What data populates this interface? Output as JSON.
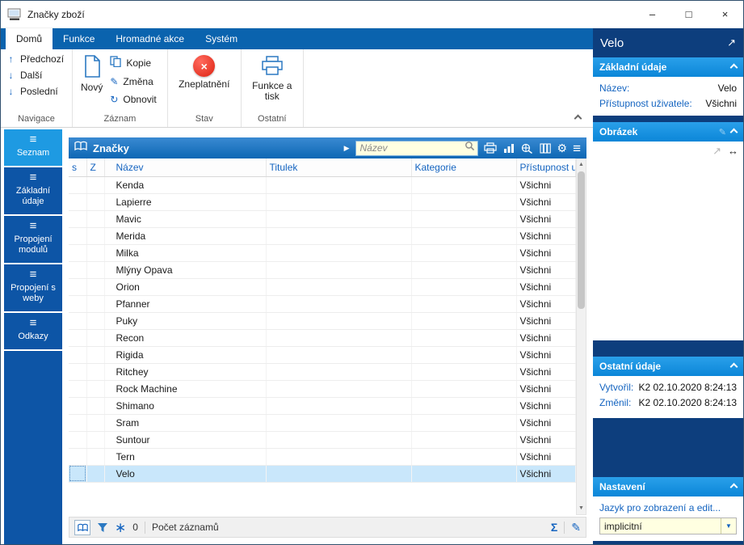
{
  "titlebar": {
    "title": "Značky zboží"
  },
  "icons": {
    "minimize": "–",
    "maximize": "□",
    "close": "×",
    "cross": "×",
    "arrow_up": "↑",
    "arrow_down": "↓",
    "triangle_right": "▶",
    "pencil": "✎",
    "refresh": "↻",
    "gear": "⚙",
    "menu": "≡",
    "sum": "Σ",
    "star": "∗",
    "expand": "↗",
    "resize_h": "↔",
    "dropdown": "▼",
    "scroll_up": "▲",
    "scroll_down": "▼"
  },
  "ribbon": {
    "tabs": [
      {
        "label": "Domů",
        "active": true
      },
      {
        "label": "Funkce",
        "active": false
      },
      {
        "label": "Hromadné akce",
        "active": false
      },
      {
        "label": "Systém",
        "active": false
      }
    ],
    "navigace": {
      "items": [
        {
          "icon": "↑",
          "label": "Předchozí"
        },
        {
          "icon": "↓",
          "label": "Další"
        },
        {
          "icon": "↓",
          "label": "Poslední"
        }
      ],
      "group_label": "Navigace"
    },
    "zaznam": {
      "novy": "Nový",
      "kopie": "Kopie",
      "zmena": "Změna",
      "obnovit": "Obnovit",
      "group_label": "Záznam"
    },
    "stav": {
      "zneplatneni": "Zneplatnění",
      "group_label": "Stav"
    },
    "ostatni": {
      "funkce_a_tisk": "Funkce a tisk",
      "group_label": "Ostatní"
    }
  },
  "sidebar": {
    "items": [
      {
        "label": "Seznam",
        "active": true
      },
      {
        "label": "Základní údaje",
        "active": false
      },
      {
        "label": "Propojení modulů",
        "active": false
      },
      {
        "label": "Propojení s weby",
        "active": false
      },
      {
        "label": "Odkazy",
        "active": false
      }
    ]
  },
  "table": {
    "panel_title": "Značky",
    "search_placeholder": "Název",
    "columns": {
      "s": "s",
      "z": "Z",
      "nazev": "Název",
      "titulek": "Titulek",
      "kategorie": "Kategorie",
      "pristupnost": "Přístupnost uživatele"
    },
    "rows": [
      {
        "nazev": "Kenda",
        "titulek": "",
        "kategorie": "",
        "pristupnost": "Všichni",
        "selected": false
      },
      {
        "nazev": "Lapierre",
        "titulek": "",
        "kategorie": "",
        "pristupnost": "Všichni",
        "selected": false
      },
      {
        "nazev": "Mavic",
        "titulek": "",
        "kategorie": "",
        "pristupnost": "Všichni",
        "selected": false
      },
      {
        "nazev": "Merida",
        "titulek": "",
        "kategorie": "",
        "pristupnost": "Všichni",
        "selected": false
      },
      {
        "nazev": "Milka",
        "titulek": "",
        "kategorie": "",
        "pristupnost": "Všichni",
        "selected": false
      },
      {
        "nazev": "Mlýny Opava",
        "titulek": "",
        "kategorie": "",
        "pristupnost": "Všichni",
        "selected": false
      },
      {
        "nazev": "Orion",
        "titulek": "",
        "kategorie": "",
        "pristupnost": "Všichni",
        "selected": false
      },
      {
        "nazev": "Pfanner",
        "titulek": "",
        "kategorie": "",
        "pristupnost": "Všichni",
        "selected": false
      },
      {
        "nazev": "Puky",
        "titulek": "",
        "kategorie": "",
        "pristupnost": "Všichni",
        "selected": false
      },
      {
        "nazev": "Recon",
        "titulek": "",
        "kategorie": "",
        "pristupnost": "Všichni",
        "selected": false
      },
      {
        "nazev": "Rigida",
        "titulek": "",
        "kategorie": "",
        "pristupnost": "Všichni",
        "selected": false
      },
      {
        "nazev": "Ritchey",
        "titulek": "",
        "kategorie": "",
        "pristupnost": "Všichni",
        "selected": false
      },
      {
        "nazev": "Rock Machine",
        "titulek": "",
        "kategorie": "",
        "pristupnost": "Všichni",
        "selected": false
      },
      {
        "nazev": "Shimano",
        "titulek": "",
        "kategorie": "",
        "pristupnost": "Všichni",
        "selected": false
      },
      {
        "nazev": "Sram",
        "titulek": "",
        "kategorie": "",
        "pristupnost": "Všichni",
        "selected": false
      },
      {
        "nazev": "Suntour",
        "titulek": "",
        "kategorie": "",
        "pristupnost": "Všichni",
        "selected": false
      },
      {
        "nazev": "Tern",
        "titulek": "",
        "kategorie": "",
        "pristupnost": "Všichni",
        "selected": false
      },
      {
        "nazev": "Velo",
        "titulek": "",
        "kategorie": "",
        "pristupnost": "Všichni",
        "selected": true
      }
    ]
  },
  "statusbar": {
    "count_value": "0",
    "count_label": "Počet záznamů"
  },
  "detail": {
    "title": "Velo",
    "zakladni": {
      "header": "Základní údaje",
      "rows": [
        {
          "label": "Název:",
          "value": "Velo"
        },
        {
          "label": "Přístupnost uživatele:",
          "value": "Všichni"
        }
      ]
    },
    "obrazek": {
      "header": "Obrázek"
    },
    "ostatni": {
      "header": "Ostatní údaje",
      "rows": [
        {
          "label": "Vytvořil:",
          "value": "K2 02.10.2020 8:24:13"
        },
        {
          "label": "Změnil:",
          "value": "K2 02.10.2020 8:24:13"
        }
      ]
    },
    "nastaveni": {
      "header": "Nastavení",
      "language_label": "Jazyk pro zobrazení a edit...",
      "language_value": "implicitní"
    }
  }
}
